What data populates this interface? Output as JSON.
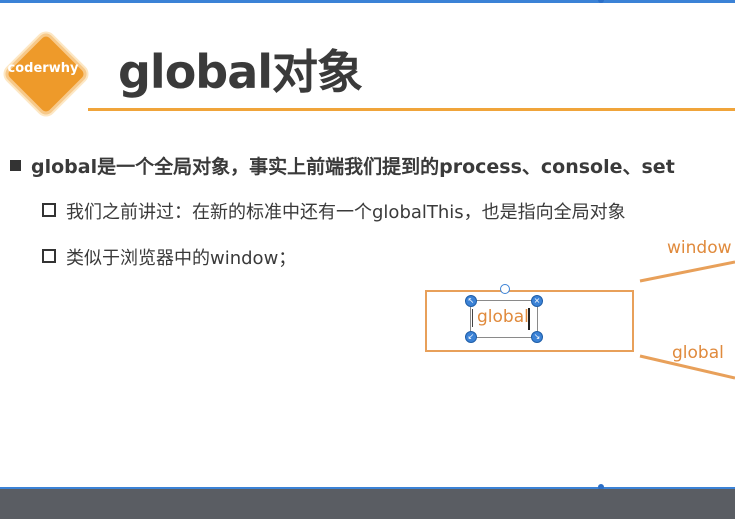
{
  "logo": {
    "text": "coderwhy"
  },
  "title": "global对象",
  "bullets": {
    "main": "global是一个全局对象，事实上前端我们提到的process、console、set",
    "subs": [
      "我们之前讲过：在新的标准中还有一个globalThis，也是指向全局对象",
      "类似于浏览器中的window；"
    ]
  },
  "diagram": {
    "textbox_value": "global",
    "label_window": "window",
    "label_global": "global"
  },
  "colors": {
    "accent": "#f0a43a",
    "logo": "#ee9a2a",
    "diagram": "#e08a3c",
    "selection": "#3b82d6",
    "bottom_bar": "#5a5d63"
  }
}
